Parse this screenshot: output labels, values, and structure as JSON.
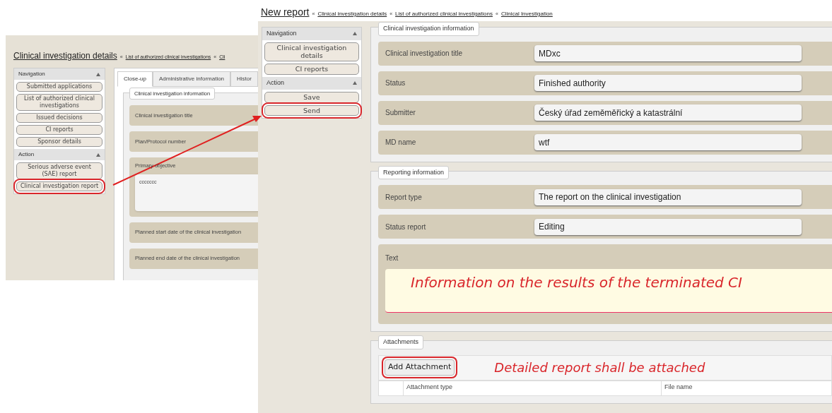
{
  "left_screen": {
    "heading": "Clinical investigation details",
    "separator": "«",
    "breadcrumbs": [
      "List of authorized clinical investigations",
      "Cli"
    ],
    "sidebar": [
      {
        "title": "Navigation",
        "items": [
          {
            "label": "Submitted applications",
            "highlighted": false
          },
          {
            "label": "List of authorized clinical investigations",
            "highlighted": false
          },
          {
            "label": "Issued decisions",
            "highlighted": false
          },
          {
            "label": "CI reports",
            "highlighted": false
          },
          {
            "label": "Sponsor details",
            "highlighted": false
          }
        ]
      },
      {
        "title": "Action",
        "items": [
          {
            "label": "Serious adverse event (SAE) report",
            "highlighted": false
          },
          {
            "label": "Clinical investigation report",
            "highlighted": true
          }
        ]
      }
    ],
    "tabs": [
      {
        "label": "Close-up",
        "selected": true
      },
      {
        "label": "Administrative information",
        "selected": false
      },
      {
        "label": "Histor",
        "selected": false
      }
    ],
    "section_title": "Clinical investigation information",
    "fields": [
      {
        "label": "Clinical investigation title",
        "kind": "text"
      },
      {
        "label": "Plan/Protocol number",
        "kind": "text"
      },
      {
        "label": "Primary objective",
        "kind": "textarea",
        "value": "ccccccc"
      },
      {
        "label": "Planned start date of the clinical investigation",
        "kind": "text"
      },
      {
        "label": "Planned end date of the clinical investigation",
        "kind": "text"
      }
    ]
  },
  "right_screen": {
    "heading": "New report",
    "separator": "«",
    "breadcrumbs": [
      "Clinical investigation details",
      "List of authorized clinical investigations",
      "Clinical Investigation"
    ],
    "sidebar": [
      {
        "title": "Navigation",
        "items": [
          {
            "label": "Clinical investigation details",
            "highlighted": false
          },
          {
            "label": "CI reports",
            "highlighted": false
          }
        ]
      },
      {
        "title": "Action",
        "items": [
          {
            "label": "Save",
            "highlighted": false
          },
          {
            "label": "Send",
            "highlighted": true
          }
        ]
      }
    ],
    "sections": [
      {
        "title": "Clinical investigation information",
        "fields": [
          {
            "label": "Clinical investigation title",
            "kind": "text",
            "value": "MDxc"
          },
          {
            "label": "Status",
            "kind": "text",
            "value": "Finished authority"
          },
          {
            "label": "Submitter",
            "kind": "text",
            "value": "Český úřad zeměměřický a katastrální"
          },
          {
            "label": "MD name",
            "kind": "text",
            "value": "wtf"
          }
        ]
      },
      {
        "title": "Reporting information",
        "fields": [
          {
            "label": "Report type",
            "kind": "text",
            "value": "The report on the clinical investigation"
          },
          {
            "label": "Status report",
            "kind": "text",
            "value": "Editing"
          },
          {
            "label": "Text",
            "kind": "textarea",
            "value": "Information on the results of the terminated CI"
          }
        ]
      }
    ],
    "attachments": {
      "title": "Attachments",
      "button": {
        "label": "Add Attachment",
        "highlighted": true
      },
      "note": "Detailed report shall be attached",
      "columns": [
        "Attachment type",
        "File name"
      ]
    }
  }
}
